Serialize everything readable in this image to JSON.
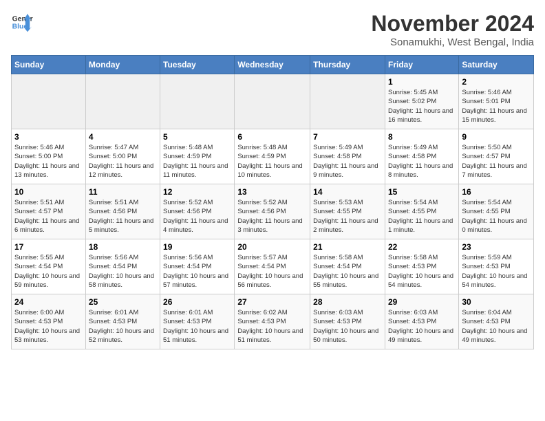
{
  "logo": {
    "line1": "General",
    "line2": "Blue"
  },
  "title": "November 2024",
  "location": "Sonamukhi, West Bengal, India",
  "weekdays": [
    "Sunday",
    "Monday",
    "Tuesday",
    "Wednesday",
    "Thursday",
    "Friday",
    "Saturday"
  ],
  "weeks": [
    [
      {
        "day": "",
        "info": ""
      },
      {
        "day": "",
        "info": ""
      },
      {
        "day": "",
        "info": ""
      },
      {
        "day": "",
        "info": ""
      },
      {
        "day": "",
        "info": ""
      },
      {
        "day": "1",
        "info": "Sunrise: 5:45 AM\nSunset: 5:02 PM\nDaylight: 11 hours and 16 minutes."
      },
      {
        "day": "2",
        "info": "Sunrise: 5:46 AM\nSunset: 5:01 PM\nDaylight: 11 hours and 15 minutes."
      }
    ],
    [
      {
        "day": "3",
        "info": "Sunrise: 5:46 AM\nSunset: 5:00 PM\nDaylight: 11 hours and 13 minutes."
      },
      {
        "day": "4",
        "info": "Sunrise: 5:47 AM\nSunset: 5:00 PM\nDaylight: 11 hours and 12 minutes."
      },
      {
        "day": "5",
        "info": "Sunrise: 5:48 AM\nSunset: 4:59 PM\nDaylight: 11 hours and 11 minutes."
      },
      {
        "day": "6",
        "info": "Sunrise: 5:48 AM\nSunset: 4:59 PM\nDaylight: 11 hours and 10 minutes."
      },
      {
        "day": "7",
        "info": "Sunrise: 5:49 AM\nSunset: 4:58 PM\nDaylight: 11 hours and 9 minutes."
      },
      {
        "day": "8",
        "info": "Sunrise: 5:49 AM\nSunset: 4:58 PM\nDaylight: 11 hours and 8 minutes."
      },
      {
        "day": "9",
        "info": "Sunrise: 5:50 AM\nSunset: 4:57 PM\nDaylight: 11 hours and 7 minutes."
      }
    ],
    [
      {
        "day": "10",
        "info": "Sunrise: 5:51 AM\nSunset: 4:57 PM\nDaylight: 11 hours and 6 minutes."
      },
      {
        "day": "11",
        "info": "Sunrise: 5:51 AM\nSunset: 4:56 PM\nDaylight: 11 hours and 5 minutes."
      },
      {
        "day": "12",
        "info": "Sunrise: 5:52 AM\nSunset: 4:56 PM\nDaylight: 11 hours and 4 minutes."
      },
      {
        "day": "13",
        "info": "Sunrise: 5:52 AM\nSunset: 4:56 PM\nDaylight: 11 hours and 3 minutes."
      },
      {
        "day": "14",
        "info": "Sunrise: 5:53 AM\nSunset: 4:55 PM\nDaylight: 11 hours and 2 minutes."
      },
      {
        "day": "15",
        "info": "Sunrise: 5:54 AM\nSunset: 4:55 PM\nDaylight: 11 hours and 1 minute."
      },
      {
        "day": "16",
        "info": "Sunrise: 5:54 AM\nSunset: 4:55 PM\nDaylight: 11 hours and 0 minutes."
      }
    ],
    [
      {
        "day": "17",
        "info": "Sunrise: 5:55 AM\nSunset: 4:54 PM\nDaylight: 10 hours and 59 minutes."
      },
      {
        "day": "18",
        "info": "Sunrise: 5:56 AM\nSunset: 4:54 PM\nDaylight: 10 hours and 58 minutes."
      },
      {
        "day": "19",
        "info": "Sunrise: 5:56 AM\nSunset: 4:54 PM\nDaylight: 10 hours and 57 minutes."
      },
      {
        "day": "20",
        "info": "Sunrise: 5:57 AM\nSunset: 4:54 PM\nDaylight: 10 hours and 56 minutes."
      },
      {
        "day": "21",
        "info": "Sunrise: 5:58 AM\nSunset: 4:54 PM\nDaylight: 10 hours and 55 minutes."
      },
      {
        "day": "22",
        "info": "Sunrise: 5:58 AM\nSunset: 4:53 PM\nDaylight: 10 hours and 54 minutes."
      },
      {
        "day": "23",
        "info": "Sunrise: 5:59 AM\nSunset: 4:53 PM\nDaylight: 10 hours and 54 minutes."
      }
    ],
    [
      {
        "day": "24",
        "info": "Sunrise: 6:00 AM\nSunset: 4:53 PM\nDaylight: 10 hours and 53 minutes."
      },
      {
        "day": "25",
        "info": "Sunrise: 6:01 AM\nSunset: 4:53 PM\nDaylight: 10 hours and 52 minutes."
      },
      {
        "day": "26",
        "info": "Sunrise: 6:01 AM\nSunset: 4:53 PM\nDaylight: 10 hours and 51 minutes."
      },
      {
        "day": "27",
        "info": "Sunrise: 6:02 AM\nSunset: 4:53 PM\nDaylight: 10 hours and 51 minutes."
      },
      {
        "day": "28",
        "info": "Sunrise: 6:03 AM\nSunset: 4:53 PM\nDaylight: 10 hours and 50 minutes."
      },
      {
        "day": "29",
        "info": "Sunrise: 6:03 AM\nSunset: 4:53 PM\nDaylight: 10 hours and 49 minutes."
      },
      {
        "day": "30",
        "info": "Sunrise: 6:04 AM\nSunset: 4:53 PM\nDaylight: 10 hours and 49 minutes."
      }
    ]
  ]
}
